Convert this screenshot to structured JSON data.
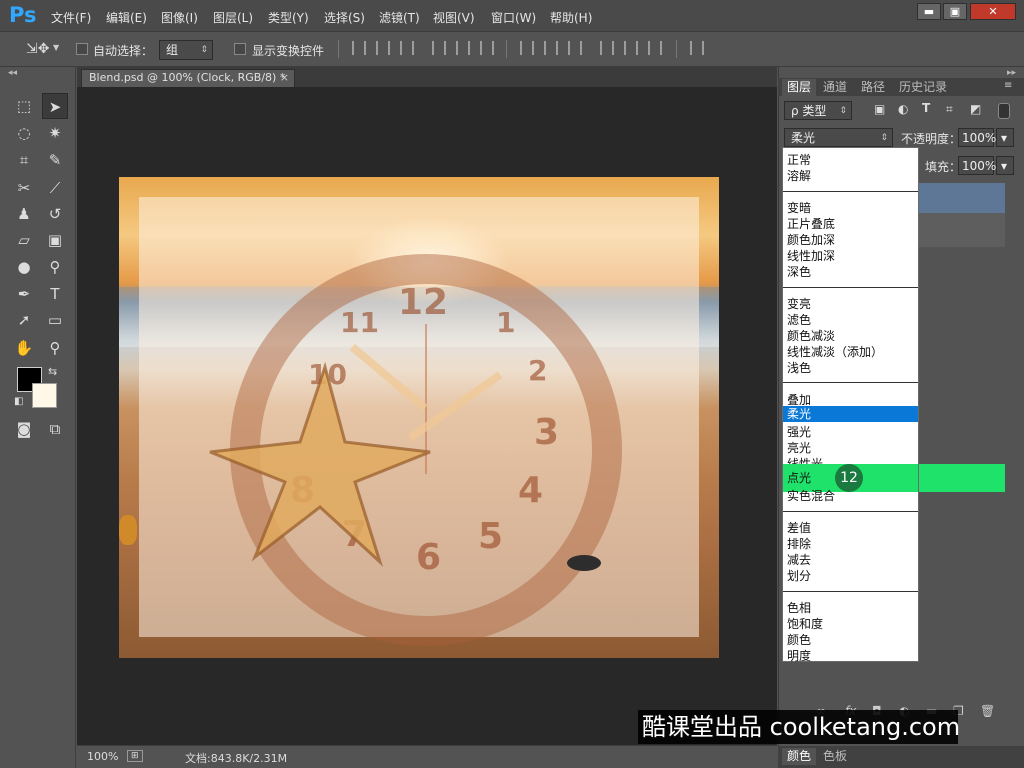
{
  "app": {
    "logo": "Ps"
  },
  "menu": [
    "文件(F)",
    "编辑(E)",
    "图像(I)",
    "图层(L)",
    "类型(Y)",
    "选择(S)",
    "滤镜(T)",
    "视图(V)",
    "窗口(W)",
    "帮助(H)"
  ],
  "window_controls": {
    "minimize": "▬",
    "restore": "▣",
    "close": "✕"
  },
  "options": {
    "auto_select_label": "自动选择：",
    "auto_select_value": "组",
    "show_transform_label": "显示变换控件"
  },
  "document": {
    "tab_title": "Blend.psd @ 100% (Clock, RGB/8) *",
    "zoom": "100%",
    "doc_info": "文档:843.8K/2.31M"
  },
  "clock_numbers": [
    "12",
    "1",
    "2",
    "3",
    "4",
    "5",
    "6",
    "7",
    "8",
    "10",
    "11"
  ],
  "panel": {
    "tabs": [
      "图层",
      "通道",
      "路径",
      "历史记录"
    ],
    "kind_filter": "ρ 类型",
    "blend_mode": "柔光",
    "opacity_label": "不透明度：",
    "opacity_value": "100%",
    "fill_label": "填充：",
    "fill_value": "100%"
  },
  "blend_modes": {
    "group1": [
      "正常",
      "溶解"
    ],
    "group2": [
      "变暗",
      "正片叠底",
      "颜色加深",
      "线性加深",
      "深色"
    ],
    "group3": [
      "变亮",
      "滤色",
      "颜色减淡",
      "线性减淡（添加）",
      "浅色"
    ],
    "group4": [
      "叠加",
      "柔光",
      "强光",
      "亮光",
      "线性光",
      "点光",
      "实色混合"
    ],
    "group5": [
      "差值",
      "排除",
      "减去",
      "划分"
    ],
    "group6": [
      "色相",
      "饱和度",
      "颜色",
      "明度"
    ],
    "selected": "柔光",
    "hovered": "点光"
  },
  "step_badge": "12",
  "watermark": "酷课堂出品 coolketang.com",
  "color_tabs": [
    "颜色",
    "色板"
  ],
  "colors": {
    "selection_blue": "#0a78d7",
    "highlight_green": "#1ee26a",
    "ps_blue": "#31a8ff"
  }
}
